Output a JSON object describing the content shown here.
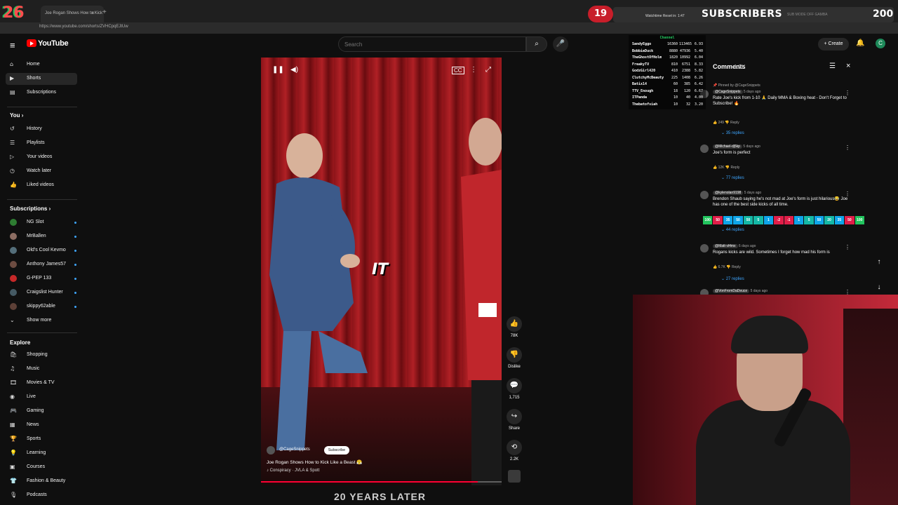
{
  "browser": {
    "tab_title": "Joe Rogan Shows How to Kick ...",
    "tab_close": "×",
    "new_tab": "+",
    "url": "https://www.youtube.com/shorts/ZVHCpqEJtUw"
  },
  "overlay": {
    "left_count": "26",
    "badge": "19",
    "small_text": "Watchtime Reset in: 1:47",
    "subscribers_label": "SUBSCRIBERS",
    "mode_text": "SUB MODE  OFF      GAMBA",
    "subscribers_count": "200"
  },
  "header": {
    "menu_icon": "≡",
    "logo_text": "YouTube",
    "search_placeholder": "Search",
    "search_icon": "⌕",
    "mic_icon": "🎤",
    "create_label": "+ Create",
    "bell_icon": "🔔",
    "avatar_letter": "C"
  },
  "sidebar": {
    "main": [
      {
        "icon": "⌂",
        "label": "Home"
      },
      {
        "icon": "▶",
        "label": "Shorts"
      },
      {
        "icon": "▤",
        "label": "Subscriptions"
      }
    ],
    "you_title": "You ›",
    "you": [
      {
        "icon": "↺",
        "label": "History"
      },
      {
        "icon": "☰",
        "label": "Playlists"
      },
      {
        "icon": "▷",
        "label": "Your videos"
      },
      {
        "icon": "◷",
        "label": "Watch later"
      },
      {
        "icon": "👍",
        "label": "Liked videos"
      }
    ],
    "subs_title": "Subscriptions ›",
    "subs": [
      {
        "label": "NG Slot",
        "color": "#2e7d32"
      },
      {
        "label": "MrBallen",
        "color": "#8d6e63"
      },
      {
        "label": "Old's Cool Kevmo",
        "color": "#546e7a"
      },
      {
        "label": "Anthony James57",
        "color": "#6d4c41"
      },
      {
        "label": "G-PEP 133",
        "color": "#c62828"
      },
      {
        "label": "Craigslist Hunter",
        "color": "#455a64"
      },
      {
        "label": "skippy62able",
        "color": "#5d4037"
      }
    ],
    "show_more": "Show more",
    "explore_title": "Explore",
    "explore": [
      {
        "icon": "🛍",
        "label": "Shopping"
      },
      {
        "icon": "♫",
        "label": "Music"
      },
      {
        "icon": "🎞",
        "label": "Movies & TV"
      },
      {
        "icon": "◉",
        "label": "Live"
      },
      {
        "icon": "🎮",
        "label": "Gaming"
      },
      {
        "icon": "▦",
        "label": "News"
      },
      {
        "icon": "🏆",
        "label": "Sports"
      },
      {
        "icon": "💡",
        "label": "Learning"
      },
      {
        "icon": "▣",
        "label": "Courses"
      },
      {
        "icon": "👕",
        "label": "Fashion & Beauty"
      },
      {
        "icon": "🎙",
        "label": "Podcasts"
      }
    ]
  },
  "video": {
    "pause_icon": "❚❚",
    "volume_icon": "◀)",
    "cc_icon": "CC",
    "more_icon": "⋮",
    "fullscreen_icon": "⤢",
    "caption": "IT",
    "channel": "@CageSnippets",
    "subscribe_label": "Subscribe",
    "title": "Joe Rogan Shows How to Kick Like a Beast 😤",
    "audio": "♪ Conspiracy · JVLA & Spott",
    "progress": 0.9,
    "below_caption": "20 YEARS LATER"
  },
  "actions": [
    {
      "name": "like",
      "icon": "👍",
      "label": "78K"
    },
    {
      "name": "dislike",
      "icon": "👎",
      "label": "Dislike"
    },
    {
      "name": "comments",
      "icon": "💬",
      "label": "1,715"
    },
    {
      "name": "share",
      "icon": "↪",
      "label": "Share"
    },
    {
      "name": "remix",
      "icon": "⟲",
      "label": "2.2K"
    }
  ],
  "stats": {
    "header": "Channel",
    "rows": [
      {
        "name": "SandyEggo",
        "a": "16360",
        "b": "113465",
        "c": "6.93"
      },
      {
        "name": "BobbieDuck",
        "a": "8880",
        "b": "47936",
        "c": "5.40"
      },
      {
        "name": "TheGhostOfHolm",
        "a": "1820",
        "b": "10992",
        "c": "6.04"
      },
      {
        "name": "FreakyTV",
        "a": "810",
        "b": "6751",
        "c": "8.33"
      },
      {
        "name": "GodzGirl420",
        "a": "410",
        "b": "2388",
        "c": "5.82"
      },
      {
        "name": "ClutchyMcBeauty",
        "a": "225",
        "b": "1408",
        "c": "6.26"
      },
      {
        "name": "Batix14",
        "a": "60",
        "b": "385",
        "c": "6.42"
      },
      {
        "name": "TTV_Enough",
        "a": "18",
        "b": "120",
        "c": "6.67"
      },
      {
        "name": "ITPanda",
        "a": "10",
        "b": "40",
        "c": "4.00"
      },
      {
        "name": "Thebatofsiah",
        "a": "10",
        "b": "32",
        "c": "3.20"
      }
    ]
  },
  "comments": {
    "title": "Comments",
    "count": "1.7K",
    "sort_icon": "☰",
    "close_icon": "×",
    "pinned": "📌 Pinned by @CageSnippets",
    "items": [
      {
        "handle": "@CageSnippets",
        "age": "5 days ago",
        "text": "Rate Joe's kick from 1-10 🙏 Daily MMA & Boxing heat - Don't Forget to Subscribe! 🔥",
        "likes": "249",
        "replies": "35 replies"
      },
      {
        "handle": "@Michael-dj5kp",
        "age": "5 days ago",
        "text": "Joe's form is perfect",
        "likes": "12K",
        "replies": "77 replies"
      },
      {
        "handle": "@kylenolan9198",
        "age": "5 days ago",
        "text": "Brendon Shaub saying he's not mad at Joe's form is just hilarious😂 Joe has one of the best side kicks of all time.",
        "likes": "",
        "replies": "44 replies"
      },
      {
        "handle": "@Matt-vl4mx",
        "age": "6 days ago",
        "text": "Rogans kicks are wild. Sometimes I forget how mad his form is",
        "likes": "6.7K",
        "replies": "27 replies"
      },
      {
        "handle": "@VonFromDaDeuce",
        "age": "5 days ago",
        "text": "",
        "likes": "",
        "replies": ""
      }
    ],
    "reply_label": "Reply",
    "vote_bar": [
      "100",
      "50",
      "35",
      "50",
      "50",
      "5",
      "1",
      "-2",
      "-1",
      "1",
      "5",
      "50",
      "20",
      "35",
      "50",
      "100"
    ],
    "vote_colors": [
      "#22c55e",
      "#e11d48",
      "#0ea5e9",
      "#0ea5e9",
      "#14b8a6",
      "#14b8a6",
      "#0ea5e9",
      "#e11d48",
      "#e11d48",
      "#0ea5e9",
      "#14b8a6",
      "#0ea5e9",
      "#14b8a6",
      "#0ea5e9",
      "#e11d48",
      "#22c55e"
    ],
    "scroll_up": "↑",
    "scroll_down": "↓"
  }
}
